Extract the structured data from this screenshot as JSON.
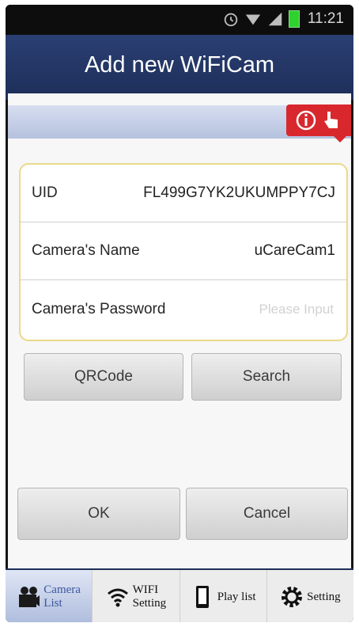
{
  "status_bar": {
    "time": "11:21"
  },
  "header": {
    "title": "Add new WiFiCam"
  },
  "form": {
    "rows": [
      {
        "label": "UID",
        "value": "FL499G7YK2UKUMPPY7CJ"
      },
      {
        "label": "Camera's Name",
        "value": "uCareCam1"
      },
      {
        "label": "Camera's Password",
        "value": "",
        "placeholder": "Please Input"
      }
    ]
  },
  "buttons": {
    "qrcode": "QRCode",
    "search": "Search",
    "ok": "OK",
    "cancel": "Cancel"
  },
  "tabs": [
    {
      "line1": "Camera",
      "line2": "List",
      "icon": "camera-list-icon",
      "active": true
    },
    {
      "line1": "WIFI",
      "line2": "Setting",
      "icon": "wifi-icon",
      "active": false
    },
    {
      "line1": "Play list",
      "line2": "",
      "icon": "phone-icon",
      "active": false
    },
    {
      "line1": "Setting",
      "line2": "",
      "icon": "gear-icon",
      "active": false
    }
  ],
  "colors": {
    "title_bar": "#1d2e58",
    "help_button": "#d8282e",
    "form_border": "#ead98a",
    "active_tab_text": "#3b55a1"
  }
}
